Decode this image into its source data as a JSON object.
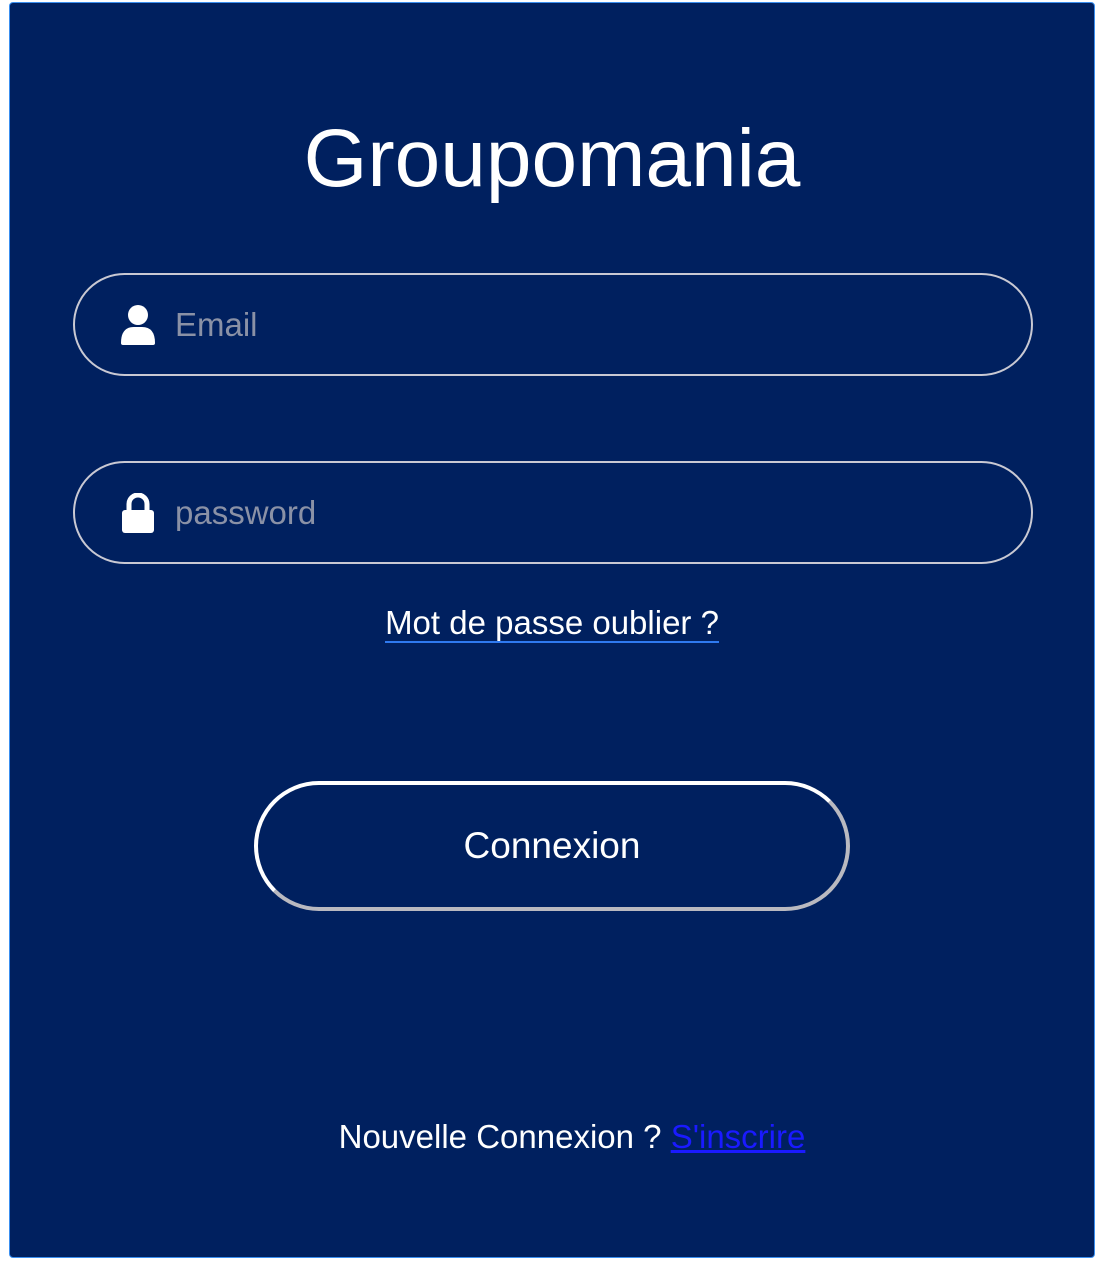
{
  "app": {
    "title": "Groupomania"
  },
  "form": {
    "email": {
      "placeholder": "Email",
      "value": "",
      "icon": "user-icon"
    },
    "password": {
      "placeholder": "password",
      "value": "",
      "icon": "lock-icon"
    },
    "forgot_link": "Mot de passe oublier ?",
    "submit_label": "Connexion"
  },
  "footer": {
    "prompt": "Nouvelle Connexion ?",
    "signup_link": "S'inscrire"
  },
  "colors": {
    "background": "#00205f",
    "text": "#ffffff",
    "link": "#1a1aff",
    "field_border": "#c9c9d3"
  }
}
